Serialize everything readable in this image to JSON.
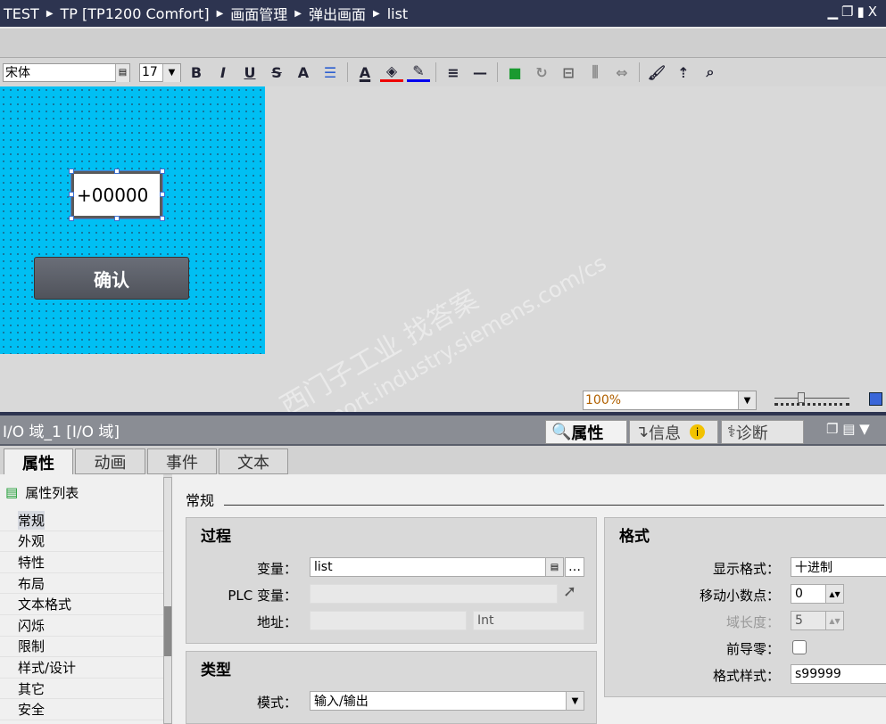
{
  "breadcrumb": [
    "TEST",
    "TP [TP1200 Comfort]",
    "画面管理",
    "弹出画面",
    "list"
  ],
  "window_controls": [
    "minimize",
    "restore",
    "maximize",
    "close"
  ],
  "toolbar": {
    "font": "宋体",
    "font_size": "17",
    "bold": "B",
    "italic": "I",
    "underline": "U",
    "strike": "S",
    "grow": "A",
    "fontcolor": "A"
  },
  "screen": {
    "io_value": "+00000",
    "button_label": "确认",
    "screen_color": "#00bff3"
  },
  "zoom": {
    "value": "100%"
  },
  "inspector": {
    "title": "I/O 域_1 [I/O 域]",
    "panel_tabs": [
      "属性",
      "信息",
      "诊断"
    ],
    "sub_tabs": [
      "属性",
      "动画",
      "事件",
      "文本"
    ],
    "prop_list_title": "属性列表",
    "prop_list": [
      "常规",
      "外观",
      "特性",
      "布局",
      "文本格式",
      "闪烁",
      "限制",
      "样式/设计",
      "其它",
      "安全"
    ],
    "section": "常规",
    "process": {
      "title": "过程",
      "var_label": "变量：",
      "var_value": "list",
      "plc_label": "PLC 变量：",
      "addr_label": "地址：",
      "addr_type": "Int"
    },
    "type": {
      "title": "类型",
      "mode_label": "模式：",
      "mode_value": "输入/输出"
    },
    "format": {
      "title": "格式",
      "display_label": "显示格式：",
      "display_value": "十进制",
      "dec_label": "移动小数点：",
      "dec_value": "0",
      "len_label": "域长度：",
      "len_value": "5",
      "lead_label": "前导零：",
      "pattern_label": "格式样式：",
      "pattern_value": "s99999"
    }
  },
  "watermark": [
    "西门子工业   找答案",
    "support.industry.siemens.com/cs"
  ]
}
